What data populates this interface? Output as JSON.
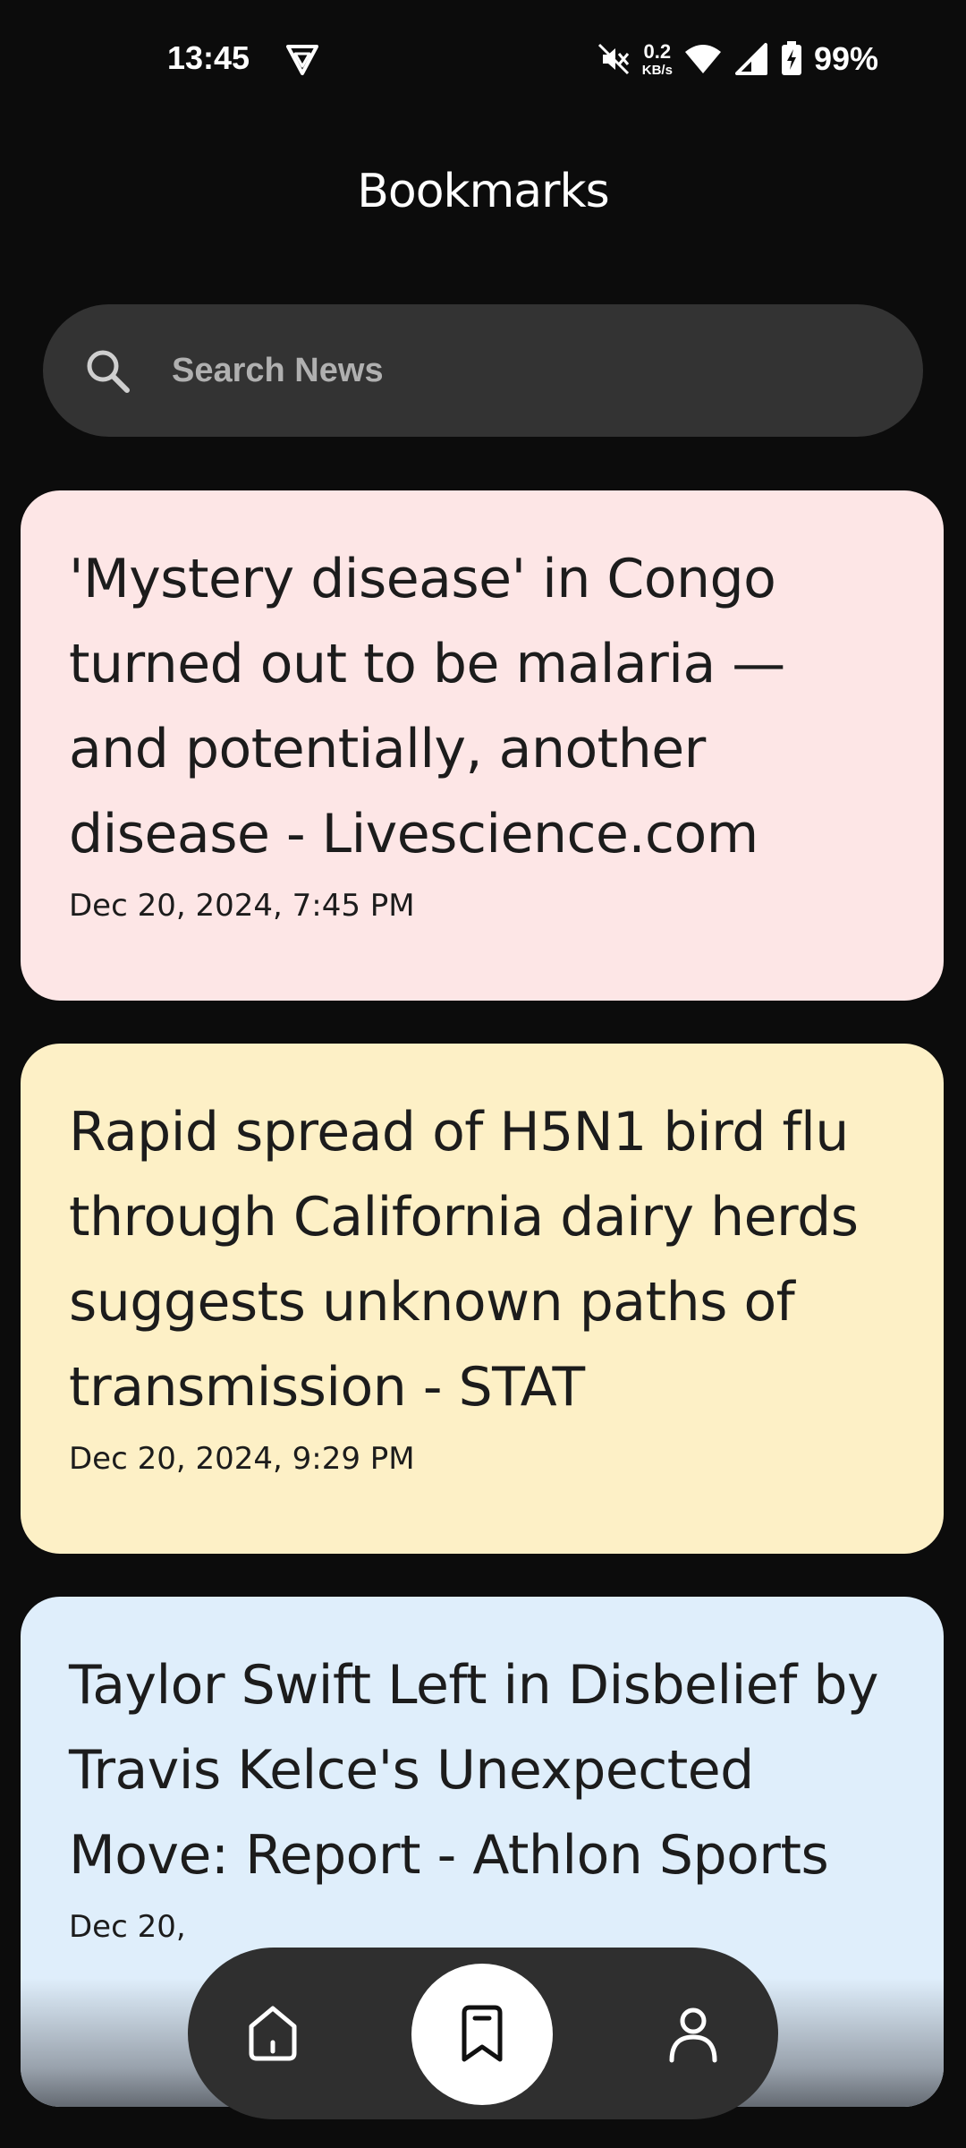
{
  "status_bar": {
    "time": "13:45",
    "net_speed_value": "0.2",
    "net_speed_unit": "KB/s",
    "battery": "99%",
    "icons": [
      "vpn-icon",
      "mute-icon",
      "wifi-icon",
      "signal-icon",
      "battery-charging-icon"
    ]
  },
  "header": {
    "title": "Bookmarks"
  },
  "search": {
    "placeholder": "Search News",
    "value": ""
  },
  "articles": [
    {
      "title": "'Mystery disease' in Congo turned out to be malaria — and potentially, another disease - Livescience.com",
      "date": "Dec 20, 2024, 7:45 PM",
      "color": "#fde6e6"
    },
    {
      "title": "Rapid spread of H5N1 bird flu through California dairy herds suggests unknown paths of transmission - STAT",
      "date": "Dec 20, 2024, 9:29 PM",
      "color": "#fdf0c6"
    },
    {
      "title": "Taylor Swift Left in Disbelief by Travis Kelce's Unexpected Move: Report - Athlon Sports",
      "date": "Dec 20,",
      "color": "#dfeefb"
    }
  ],
  "bottom_nav": {
    "items": [
      {
        "icon": "home-icon",
        "active": false
      },
      {
        "icon": "bookmark-icon",
        "active": true
      },
      {
        "icon": "profile-icon",
        "active": false
      }
    ],
    "bar_color": "#2f2f2f",
    "active_color": "#ffffff"
  }
}
